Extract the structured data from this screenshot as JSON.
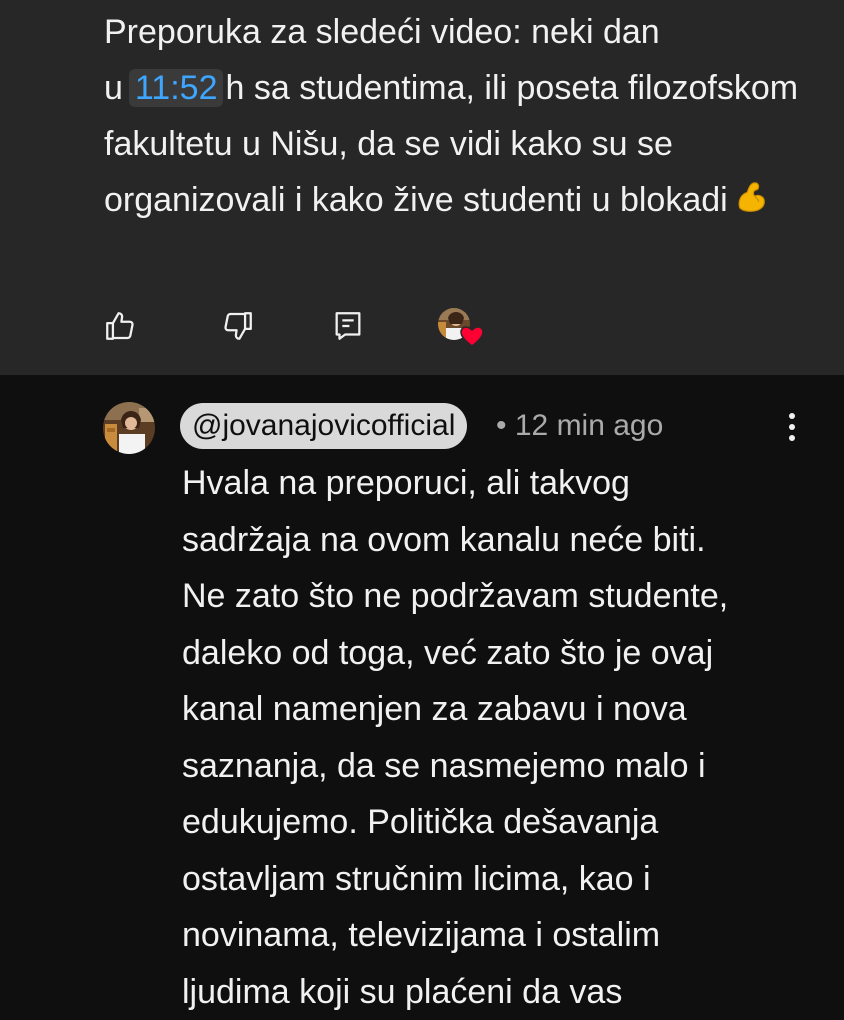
{
  "top_comment": {
    "text_part1": "Preporuka za sledeći video: neki dan u",
    "timestamp_link": "11:52",
    "text_part2": "h sa studentima, ili poseta filozofskom fakultetu u Nišu, da se vidi kako su se organizovali i kako žive studenti u blokadi",
    "emoji": "flexed-biceps-emoji",
    "actions": {
      "like_icon": "thumb-up-icon",
      "dislike_icon": "thumb-down-icon",
      "reply_icon": "comment-reply-icon",
      "creator_heart": "creator-heart-avatar"
    }
  },
  "reply": {
    "author_handle": "@jovanajovicofficial",
    "separator": "•",
    "time_ago": "12 min ago",
    "more_icon": "more-vertical-icon",
    "lines": [
      "Hvala na preporuci, ali takvog",
      "sadržaja na ovom kanalu neće biti.",
      "Ne zato što ne podržavam studente,",
      "daleko od toga, već zato što je ovaj",
      "kanal namenjen za zabavu i nova",
      "saznanja, da se nasmejemo malo i",
      "edukujemo. Politička dešavanja",
      "ostavljam stručnim licima, kao i",
      "novinama, televizijama i ostalim",
      "ljudima koji su plaćeni da vas"
    ]
  },
  "colors": {
    "top_bg": "#272727",
    "page_bg": "#0f0f0f",
    "link_blue": "#3ea6ff",
    "text": "#f1f1f1",
    "meta": "#aaaaaa",
    "handle_pill": "#d9d9d9"
  }
}
